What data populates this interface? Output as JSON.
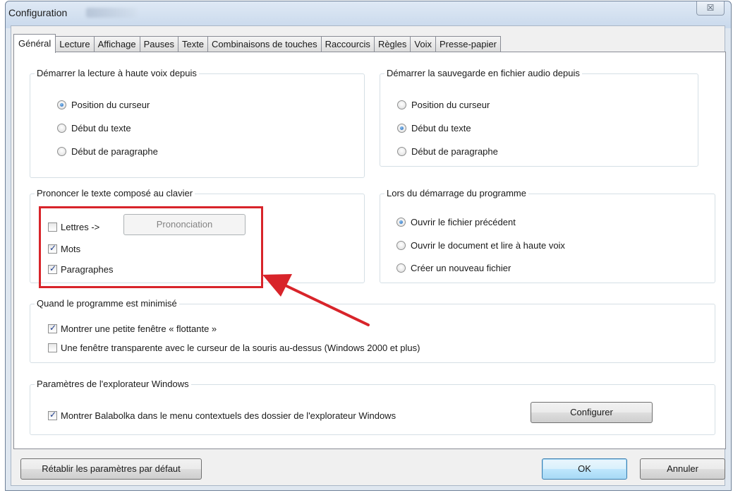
{
  "window": {
    "title": "Configuration",
    "close_symbol": "☒"
  },
  "tabs": [
    {
      "label": "Général",
      "active": true
    },
    {
      "label": "Lecture"
    },
    {
      "label": "Affichage"
    },
    {
      "label": "Pauses"
    },
    {
      "label": "Texte"
    },
    {
      "label": "Combinaisons de touches"
    },
    {
      "label": "Raccourcis"
    },
    {
      "label": "Règles"
    },
    {
      "label": "Voix"
    },
    {
      "label": "Presse-papier"
    }
  ],
  "read_aloud_group": {
    "title": "Démarrer la lecture à haute voix depuis",
    "options": [
      "Position du curseur",
      "Début du texte",
      "Début de paragraphe"
    ],
    "selected": "Position du curseur"
  },
  "save_audio_group": {
    "title": "Démarrer la sauvegarde en fichier audio depuis",
    "options": [
      "Position du curseur",
      "Début du texte",
      "Début de paragraphe"
    ],
    "selected": "Début du texte"
  },
  "typed_text_group": {
    "title": "Prononcer le texte composé au clavier",
    "letters_label": "Lettres ->",
    "letters_checked": false,
    "pronunciation_button": "Prononciation",
    "words_label": "Mots",
    "words_checked": true,
    "paragraphs_label": "Paragraphes",
    "paragraphs_checked": true
  },
  "startup_group": {
    "title": "Lors du démarrage du programme",
    "options": [
      "Ouvrir le fichier précédent",
      "Ouvrir le document et lire à haute voix",
      "Créer un nouveau fichier"
    ],
    "selected": "Ouvrir le fichier précédent"
  },
  "minimized_group": {
    "title": "Quand le programme est minimisé",
    "floating_label": "Montrer une petite fenêtre « flottante »",
    "floating_checked": true,
    "transparent_label": "Une fenêtre transparente avec le curseur de la souris au-dessus (Windows 2000 et plus)",
    "transparent_checked": false
  },
  "explorer_group": {
    "title": "Paramètres de l'explorateur Windows",
    "context_menu_label": "Montrer Balabolka dans le menu contextuels des dossier de l'explorateur Windows",
    "context_menu_checked": true,
    "configure_button": "Configurer"
  },
  "footer": {
    "reset_button": "Rétablir les paramètres par défaut",
    "ok_button": "OK",
    "cancel_button": "Annuler"
  },
  "colors": {
    "highlight": "#d8242a",
    "accent": "#1a5fb4"
  }
}
